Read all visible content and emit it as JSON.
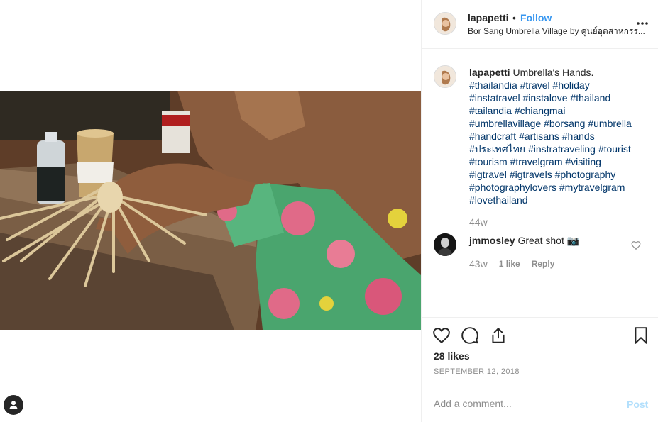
{
  "post": {
    "username": "lapapetti",
    "separator": "•",
    "follow_label": "Follow",
    "location": "Bor Sang Umbrella Village by ศูนย์อุตสาหกรร...",
    "more_icon": "more-horizontal-icon"
  },
  "caption": {
    "username": "lapapetti",
    "text": "Umbrella's Hands.",
    "hashtags": [
      "#thailandia",
      "#travel",
      "#holiday",
      "#instatravel",
      "#instalove",
      "#thailand",
      "#tailandia",
      "#chiangmai",
      "#umbrellavillage",
      "#borsang",
      "#umbrella",
      "#handcraft",
      "#artisans",
      "#hands",
      "#ประเทศไทย",
      "#instratraveling",
      "#tourist",
      "#tourism",
      "#travelgram",
      "#visiting",
      "#igtravel",
      "#igtravels",
      "#photography",
      "#photographylovers",
      "#mytravelgram",
      "#lovethailand"
    ],
    "time": "44w"
  },
  "comment": {
    "username": "jmmosley",
    "text": "Great shot 📷",
    "time": "43w",
    "likes_label": "1 like",
    "reply_label": "Reply"
  },
  "actions": {
    "likes": "28 likes",
    "date": "SEPTEMBER 12, 2018"
  },
  "add_comment": {
    "placeholder": "Add a comment...",
    "post_label": "Post"
  },
  "colors": {
    "link_blue": "#3897f0",
    "hashtag": "#003569",
    "muted": "#8e8e8e",
    "post_disabled": "#b2dffc"
  }
}
